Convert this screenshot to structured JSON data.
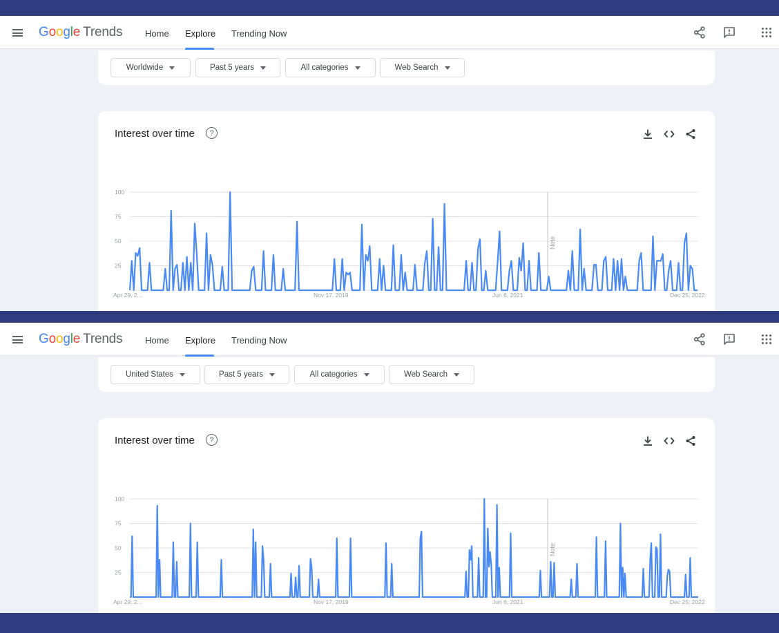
{
  "app": {
    "logo_google": [
      "G",
      "o",
      "o",
      "g",
      "l",
      "e"
    ],
    "logo_trends": "Trends",
    "nav": [
      "Home",
      "Explore",
      "Trending Now"
    ],
    "active_nav": "Explore"
  },
  "colors": {
    "frame": "#2f3d7e",
    "line": "#4a8af4",
    "logo": [
      "#4285f4",
      "#ea4335",
      "#fbbc05",
      "#4285f4",
      "#34a853",
      "#ea4335"
    ]
  },
  "icons": {
    "topbar": [
      "menu-icon",
      "share-icon",
      "feedback-icon",
      "apps-icon"
    ],
    "card": [
      "help-icon",
      "download-icon",
      "embed-icon",
      "share-icon"
    ]
  },
  "panels": [
    {
      "filters": [
        "Worldwide",
        "Past 5 years",
        "All categories",
        "Web Search"
      ],
      "chart_title": "Interest over time",
      "help_glyph": "?",
      "chart_data": {
        "type": "line",
        "title": "",
        "y_ticks": [
          100,
          75,
          50,
          25
        ],
        "ylim": [
          0,
          100
        ],
        "x_tick_labels": [
          "Apr 29, 2...",
          "Nov 17, 2019",
          "Jun 6, 2021",
          "Dec 25, 2022"
        ],
        "grid": true,
        "note_label": "Note",
        "last_segment_dashed": true,
        "series": [
          {
            "values": [
              0,
              30,
              0,
              38,
              35,
              43,
              0,
              0,
              0,
              0,
              28,
              0,
              0,
              0,
              0,
              0,
              0,
              0,
              22,
              0,
              0,
              81,
              0,
              22,
              26,
              0,
              0,
              28,
              0,
              34,
              0,
              28,
              0,
              68,
              38,
              0,
              0,
              0,
              0,
              58,
              0,
              36,
              26,
              0,
              0,
              0,
              0,
              24,
              0,
              0,
              0,
              100,
              0,
              0,
              0,
              0,
              0,
              0,
              0,
              0,
              0,
              0,
              20,
              24,
              0,
              0,
              0,
              0,
              40,
              0,
              0,
              0,
              0,
              36,
              0,
              0,
              0,
              0,
              22,
              0,
              0,
              0,
              0,
              0,
              0,
              70,
              0,
              0,
              0,
              0,
              0,
              0,
              0,
              0,
              0,
              0,
              0,
              0,
              0,
              0,
              0,
              0,
              0,
              0,
              32,
              0,
              0,
              0,
              32,
              0,
              18,
              16,
              18,
              0,
              0,
              0,
              0,
              0,
              67,
              0,
              36,
              30,
              45,
              0,
              0,
              0,
              0,
              32,
              0,
              25,
              0,
              0,
              0,
              0,
              46,
              0,
              0,
              0,
              36,
              0,
              18,
              0,
              0,
              0,
              0,
              26,
              0,
              0,
              0,
              0,
              28,
              40,
              0,
              0,
              73,
              0,
              0,
              44,
              0,
              0,
              88,
              0,
              0,
              0,
              0,
              0,
              0,
              0,
              0,
              0,
              0,
              30,
              0,
              0,
              28,
              0,
              0,
              42,
              52,
              0,
              0,
              20,
              0,
              0,
              0,
              0,
              0,
              28,
              60,
              0,
              0,
              0,
              0,
              20,
              30,
              0,
              0,
              0,
              33,
              20,
              48,
              0,
              0,
              30,
              0,
              0,
              0,
              0,
              38,
              0,
              0,
              0,
              0,
              14,
              0,
              0,
              0,
              0,
              0,
              0,
              0,
              0,
              0,
              20,
              0,
              40,
              0,
              0,
              0,
              62,
              0,
              22,
              0,
              0,
              0,
              0,
              26,
              26,
              0,
              0,
              0,
              30,
              34,
              0,
              0,
              0,
              32,
              0,
              30,
              0,
              32,
              0,
              14,
              0,
              0,
              0,
              0,
              0,
              0,
              30,
              38,
              0,
              0,
              0,
              0,
              0,
              55,
              0,
              30,
              30,
              30,
              37,
              0,
              0,
              20,
              30,
              0,
              0,
              0,
              28,
              0,
              0,
              48,
              58,
              0,
              25,
              22,
              0,
              0,
              0
            ]
          }
        ]
      }
    },
    {
      "filters": [
        "United States",
        "Past 5 years",
        "All categories",
        "Web Search"
      ],
      "chart_title": "Interest over time",
      "help_glyph": "?",
      "chart_data": {
        "type": "line",
        "title": "",
        "y_ticks": [
          100,
          75,
          50,
          25
        ],
        "ylim": [
          0,
          100
        ],
        "x_tick_labels": [
          "Apr 29, 2...",
          "Nov 17, 2019",
          "Jun 6, 2021",
          "Dec 25, 2022"
        ],
        "grid": true,
        "note_label": "Note",
        "last_segment_dashed": false,
        "series": [
          {
            "values": [
              0,
              0,
              62,
              0,
              0,
              0,
              0,
              0,
              0,
              0,
              0,
              0,
              0,
              0,
              0,
              0,
              0,
              0,
              0,
              0,
              0,
              0,
              0,
              0,
              93,
              0,
              38,
              0,
              0,
              0,
              0,
              0,
              0,
              0,
              0,
              0,
              0,
              0,
              56,
              0,
              0,
              36,
              0,
              0,
              0,
              0,
              0,
              0,
              0,
              0,
              0,
              0,
              0,
              75,
              0,
              0,
              0,
              0,
              0,
              56,
              0,
              0,
              0,
              0,
              0,
              0,
              0,
              0,
              0,
              0,
              0,
              0,
              0,
              0,
              0,
              0,
              0,
              0,
              0,
              0,
              38,
              0,
              0,
              0,
              0,
              0,
              0,
              0,
              0,
              0,
              0,
              0,
              0,
              0,
              0,
              0,
              0,
              0,
              0,
              0,
              0,
              0,
              0,
              0,
              0,
              0,
              0,
              0,
              69,
              0,
              56,
              0,
              0,
              0,
              0,
              0,
              52,
              38,
              0,
              0,
              0,
              0,
              0,
              34,
              0,
              0,
              0,
              0,
              0,
              0,
              0,
              0,
              0,
              0,
              0,
              0,
              0,
              0,
              0,
              0,
              0,
              24,
              0,
              0,
              0,
              20,
              0,
              0,
              32,
              0,
              0,
              0,
              0,
              0,
              0,
              0,
              0,
              0,
              39,
              30,
              0,
              0,
              0,
              0,
              0,
              18,
              0,
              0,
              0,
              0,
              0,
              0,
              0,
              0,
              0,
              0,
              0,
              0,
              0,
              0,
              0,
              60,
              0,
              0,
              0,
              0,
              0,
              0,
              0,
              0,
              0,
              0,
              0,
              60,
              0,
              0,
              0,
              0,
              0,
              0,
              0,
              0,
              0,
              0,
              0,
              0,
              0,
              0,
              0,
              0,
              0,
              0,
              0,
              0,
              0,
              0,
              0,
              0,
              0,
              0,
              0,
              0,
              0,
              0,
              55,
              0,
              0,
              0,
              0,
              34,
              0,
              0,
              0,
              0,
              0,
              0,
              0,
              0,
              0,
              0,
              0,
              0,
              0,
              0,
              0,
              0,
              0,
              0,
              0,
              0,
              0,
              0,
              0,
              0,
              60,
              67,
              0,
              0,
              0,
              0,
              0,
              0,
              0,
              0,
              0,
              0,
              0,
              0,
              0,
              0,
              0,
              0,
              0,
              0,
              0,
              0,
              0,
              0,
              0,
              0,
              0,
              0,
              0,
              0,
              0,
              0,
              0,
              0,
              0,
              0,
              0,
              0,
              0,
              0,
              26,
              0,
              0,
              48,
              38,
              52,
              0,
              0,
              0,
              0,
              0,
              40,
              0,
              0,
              0,
              0,
              100,
              0,
              0,
              70,
              31,
              46,
              33,
              0,
              0,
              0,
              0,
              94,
              0,
              30,
              0,
              0,
              0,
              0,
              0,
              0,
              0,
              0,
              0,
              65,
              0,
              0,
              0,
              0,
              0,
              0,
              0,
              0,
              0,
              0,
              0,
              0,
              0,
              0,
              0,
              0,
              0,
              0,
              0,
              0,
              0,
              0,
              0,
              0,
              0,
              27,
              0,
              0,
              0,
              0,
              0,
              0,
              0,
              0,
              36,
              0,
              0,
              35,
              0,
              0,
              0,
              0,
              0,
              0,
              0,
              0,
              0,
              0,
              0,
              0,
              0,
              0,
              18,
              0,
              0,
              0,
              0,
              34,
              0,
              0,
              0,
              0,
              0,
              0,
              0,
              0,
              0,
              0,
              0,
              0,
              0,
              0,
              0,
              0,
              61,
              0,
              0,
              0,
              0,
              0,
              0,
              0,
              57,
              0,
              0,
              0,
              0,
              0,
              0,
              0,
              0,
              0,
              0,
              0,
              0,
              75,
              0,
              30,
              0,
              24,
              0,
              0,
              0,
              0,
              0,
              0,
              0,
              0,
              0,
              0,
              0,
              0,
              0,
              0,
              0,
              29,
              0,
              0,
              0,
              0,
              0,
              38,
              55,
              0,
              0,
              0,
              51,
              49,
              0,
              0,
              64,
              0,
              0,
              0,
              0,
              0,
              22,
              28,
              26,
              0,
              0,
              0,
              0,
              0,
              0,
              0,
              0,
              0,
              0,
              0,
              0,
              0,
              23,
              0,
              0,
              0,
              40,
              0,
              0,
              0,
              0,
              0,
              0,
              0
            ]
          }
        ]
      }
    }
  ]
}
